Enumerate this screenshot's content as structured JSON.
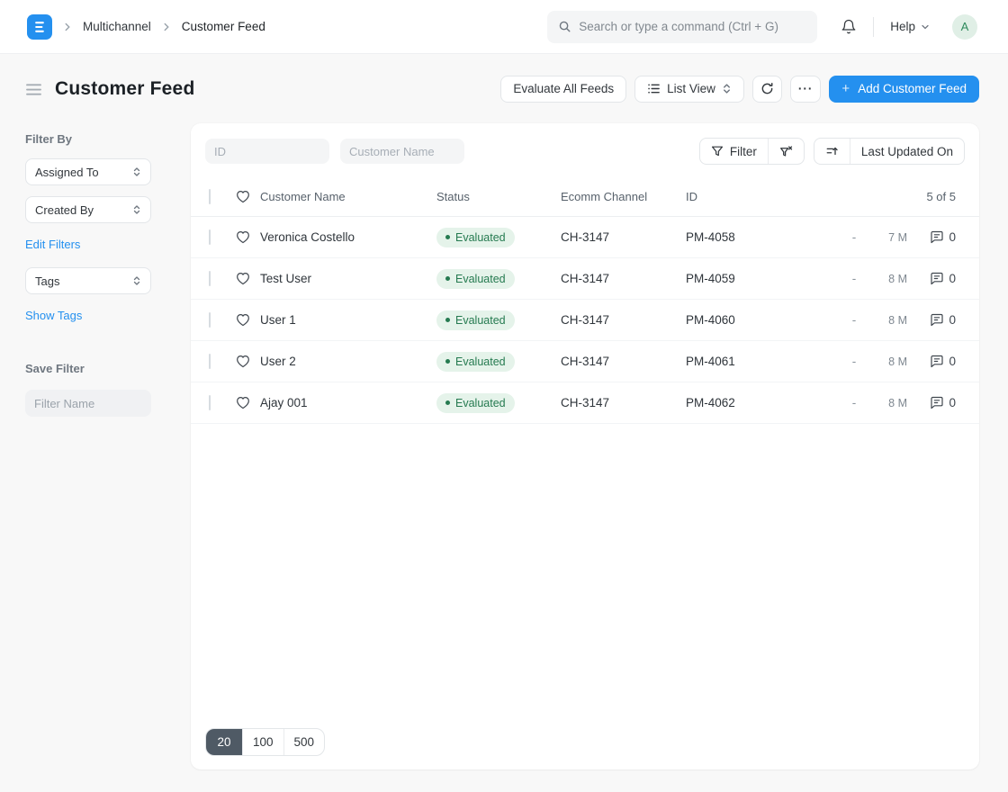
{
  "colors": {
    "accent": "#2490ef",
    "page-bg": "#f8f8f8",
    "badge-bg": "#e5f3ea",
    "badge-text": "#257a50",
    "avatar-bg": "#e0efe6",
    "avatar-text": "#2e8a5c",
    "pagesize-active": "#4f5a65"
  },
  "icons": {
    "plus": "+",
    "ellipsis": "···"
  },
  "nav": {
    "breadcrumbs": [
      {
        "label": "Multichannel"
      },
      {
        "label": "Customer Feed"
      }
    ],
    "search_placeholder": "Search or type a command (Ctrl + G)",
    "help_label": "Help",
    "avatar_letter": "A"
  },
  "page": {
    "title": "Customer Feed",
    "evaluate_button": "Evaluate All Feeds",
    "view_button": "List View",
    "add_button": "Add Customer Feed"
  },
  "sidebar": {
    "filter_by_label": "Filter By",
    "assigned_to_label": "Assigned To",
    "created_by_label": "Created By",
    "edit_filters_link": "Edit Filters",
    "tags_label": "Tags",
    "show_tags_link": "Show Tags",
    "save_filter_label": "Save Filter",
    "filter_name_placeholder": "Filter Name"
  },
  "list": {
    "filters": {
      "id_placeholder": "ID",
      "name_placeholder": "Customer Name"
    },
    "filter_button_label": "Filter",
    "sort_button_label": "Last Updated On",
    "columns": {
      "name": "Customer Name",
      "status": "Status",
      "channel": "Ecomm Channel",
      "id": "ID"
    },
    "count": "5 of 5",
    "rows": [
      {
        "name": "Veronica Costello",
        "status": "Evaluated",
        "channel": "CH-3147",
        "id": "PM-4058",
        "dash": "-",
        "modified": "7 M",
        "comments": "0"
      },
      {
        "name": "Test User",
        "status": "Evaluated",
        "channel": "CH-3147",
        "id": "PM-4059",
        "dash": "-",
        "modified": "8 M",
        "comments": "0"
      },
      {
        "name": "User 1",
        "status": "Evaluated",
        "channel": "CH-3147",
        "id": "PM-4060",
        "dash": "-",
        "modified": "8 M",
        "comments": "0"
      },
      {
        "name": "User 2",
        "status": "Evaluated",
        "channel": "CH-3147",
        "id": "PM-4061",
        "dash": "-",
        "modified": "8 M",
        "comments": "0"
      },
      {
        "name": "Ajay 001",
        "status": "Evaluated",
        "channel": "CH-3147",
        "id": "PM-4062",
        "dash": "-",
        "modified": "8 M",
        "comments": "0"
      }
    ],
    "page_sizes": [
      "20",
      "100",
      "500"
    ],
    "active_page_size": "20"
  }
}
